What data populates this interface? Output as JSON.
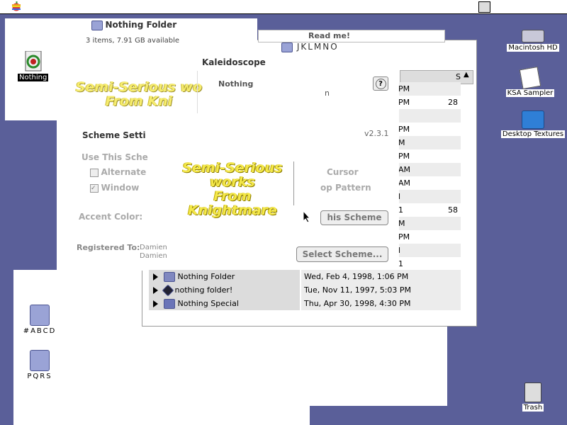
{
  "menubar": {
    "apple_label": "",
    "switcher_label": ""
  },
  "windows": {
    "nothing_folder": {
      "title": "Nothing Folder",
      "info": "3 items, 7.91 GB available",
      "icon_label": "Nothing"
    },
    "readme": {
      "title": "Read me!"
    },
    "jklmno": {
      "title": "JKLMNO",
      "header_size": "S",
      "times": [
        "PM",
        "PM",
        "",
        "PM",
        "M",
        "PM",
        "AM",
        "AM",
        "l",
        "1",
        "M",
        "PM",
        "l",
        "1"
      ],
      "sizes": [
        "",
        "28",
        "",
        "",
        "",
        "",
        "",
        "",
        "",
        "58",
        "",
        "",
        "",
        ""
      ],
      "rows": [
        {
          "name": "Nothing Folder",
          "date": "Wed, Feb 4, 1998, 1:06 PM"
        },
        {
          "name": "nothing folder!",
          "date": "Tue, Nov 11, 1997, 5:03 PM"
        },
        {
          "name": "Nothing Special",
          "date": "Thu, Apr 30, 1998, 4:30 PM"
        }
      ]
    },
    "kaleidoscope": {
      "title": "Kaleidoscope",
      "tab": "Nothing",
      "help": "?",
      "scheme_settings": "Scheme Setti",
      "version": "v2.3.1",
      "use_this_scheme": "Use This Sche",
      "alternate": "Alternate",
      "windows_cb": "Window",
      "cursor": "Cursor",
      "pattern": "op Pattern",
      "accent_color": "Accent Color:",
      "this_scheme_btn": "his Scheme",
      "registered_to": "Registered To:",
      "reg_name1": "Damien",
      "reg_name2": "Damien",
      "select_scheme_btn": "Select Scheme...",
      "fragment_n": "n"
    }
  },
  "splash": {
    "line1": "Semi-Serious works",
    "line2": "From Knightmare"
  },
  "splash_bg": {
    "line1": "Semi-Serious wo",
    "line2": "From Kni"
  },
  "desktop": {
    "macintosh_hd": "Macintosh HD",
    "ksa_sampler": "KSA Sampler",
    "desktop_textures": "Desktop Textures",
    "abcd": "#ABCD",
    "pqrs": "PQRS",
    "trash": "Trash"
  }
}
